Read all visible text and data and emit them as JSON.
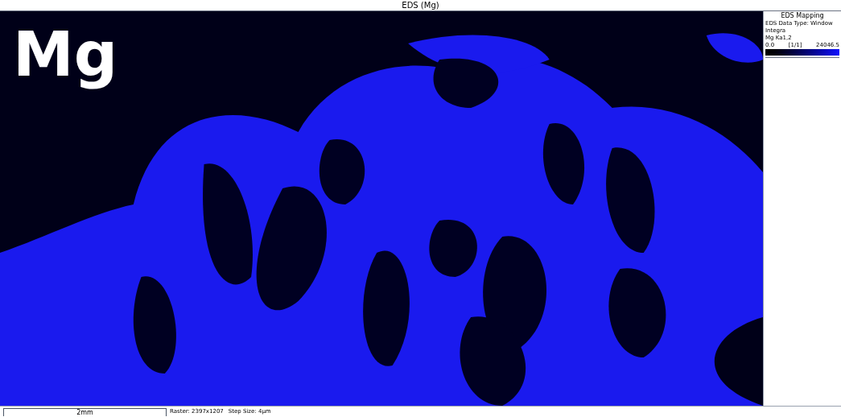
{
  "window": {
    "title": "EDS (Mg)"
  },
  "map": {
    "label": "Mg"
  },
  "legend": {
    "title": "EDS Mapping",
    "data_type": "EDS Data Type: Window Integra",
    "line": "Mg Ka1,2",
    "min": "0.0",
    "page": "[1/1]",
    "max": "24046.5"
  },
  "status_bar": {
    "scale_label": "2mm",
    "raster": "Raster: 2397x1207",
    "step_size": "Step Size: 4µm"
  }
}
